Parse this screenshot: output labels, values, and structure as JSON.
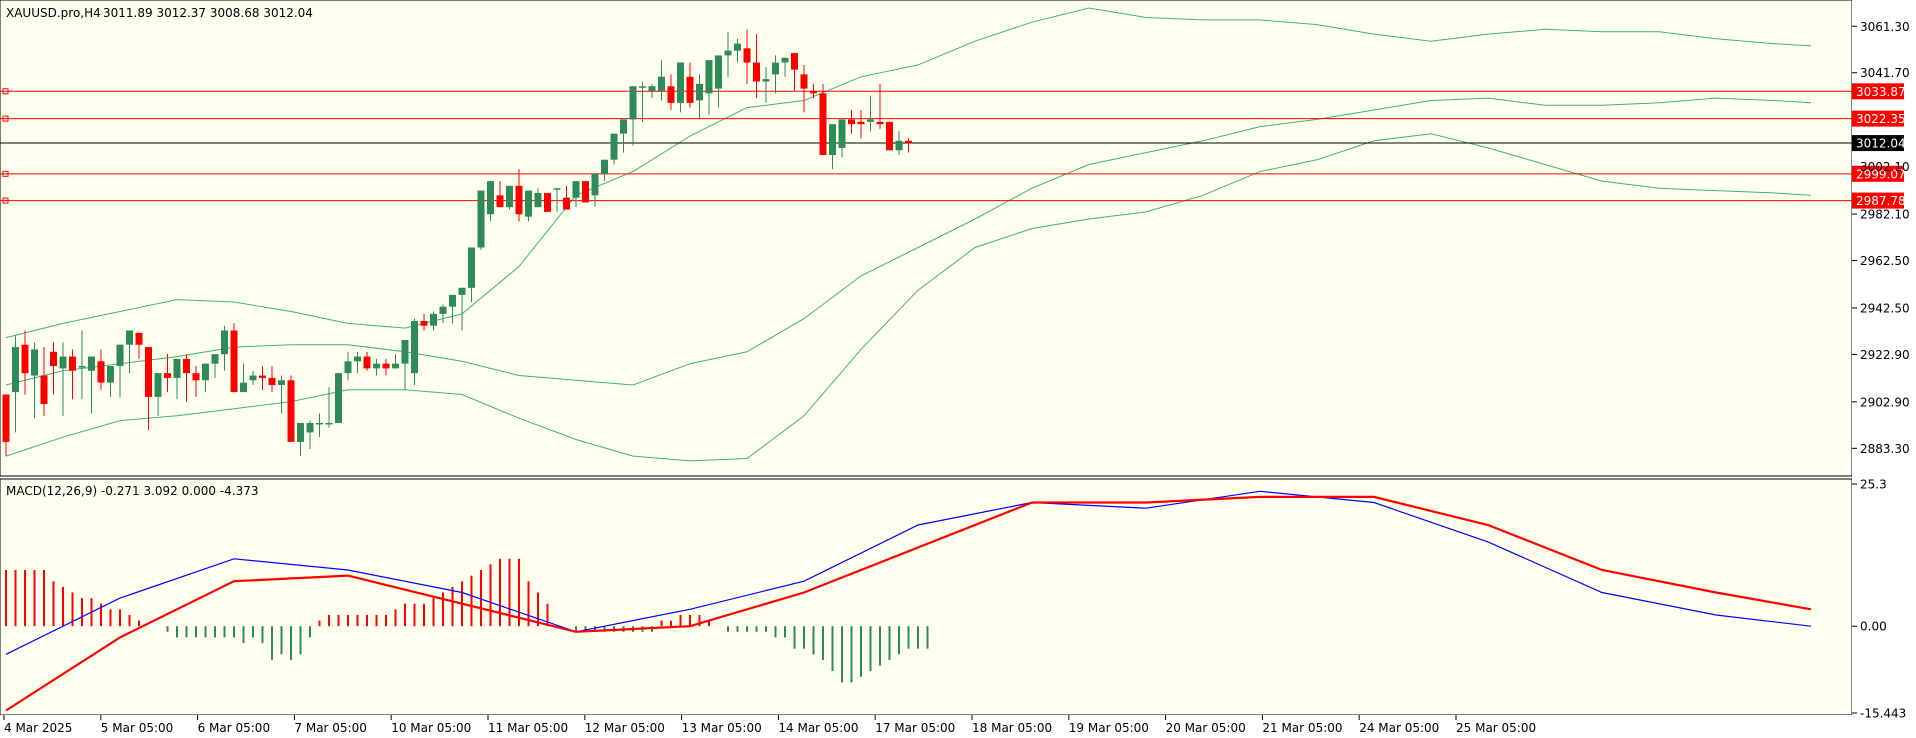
{
  "header": {
    "symbol": "XAUUSD.pro,H4",
    "ohlc": "3011.89 3012.37 3008.68 3012.04"
  },
  "macd_header": "MACD(12,26,9) -0.271 3.092 0.000 -4.373",
  "colors": {
    "background": "#fffff0",
    "bull": "#2e8b57",
    "bear": "#ff0000",
    "bands": "#3cb371",
    "macd_line": "#0000ff",
    "signal_line": "#ff0000",
    "level_line": "#ff0000",
    "price_line": "#000000"
  },
  "price_axis": [
    "3061.30",
    "3041.70",
    "2982.10",
    "2962.50",
    "2942.50",
    "2922.90",
    "2902.90",
    "2883.30"
  ],
  "macd_axis": [
    "25.3",
    "0.00",
    "-15.443"
  ],
  "time_labels": [
    "4 Mar 2025",
    "5 Mar 05:00",
    "6 Mar 05:00",
    "7 Mar 05:00",
    "10 Mar 05:00",
    "11 Mar 05:00",
    "12 Mar 05:00",
    "13 Mar 05:00",
    "14 Mar 05:00",
    "17 Mar 05:00",
    "18 Mar 05:00",
    "19 Mar 05:00",
    "20 Mar 05:00",
    "21 Mar 05:00",
    "24 Mar 05:00",
    "25 Mar 05:00"
  ],
  "levels": [
    {
      "value": 3033.87,
      "label": "3033.87"
    },
    {
      "value": 3022.35,
      "label": "3022.35"
    },
    {
      "value": 2999.07,
      "label": "2999.07"
    },
    {
      "value": 2987.78,
      "label": "2987.78"
    }
  ],
  "current_price": {
    "value": 3012.04,
    "label": "3012.04"
  },
  "partial_axis_label": "3002.10",
  "chart_data": {
    "type": "candlestick",
    "price_range": [
      2875,
      3069
    ],
    "macd_range": [
      -15.443,
      25.3
    ],
    "candles": [
      [
        2906,
        2906,
        2880,
        2886
      ],
      [
        2907,
        2931,
        2890,
        2926
      ],
      [
        2927,
        2933,
        2906,
        2915
      ],
      [
        2914,
        2928,
        2896,
        2925
      ],
      [
        2914,
        2926,
        2897,
        2902
      ],
      [
        2924,
        2928,
        2906,
        2918
      ],
      [
        2917,
        2928,
        2897,
        2922
      ],
      [
        2922,
        2925,
        2904,
        2916
      ],
      [
        2918,
        2933,
        2904,
        2918
      ],
      [
        2916,
        2920,
        2898,
        2922
      ],
      [
        2920,
        2925,
        2908,
        2911
      ],
      [
        2911,
        2915,
        2905,
        2918
      ],
      [
        2918,
        2919,
        2905,
        2927
      ],
      [
        2927,
        2929,
        2915,
        2933
      ],
      [
        2932,
        2930,
        2921,
        2927
      ],
      [
        2926,
        2926,
        2891,
        2905
      ],
      [
        2905,
        2914,
        2897,
        2915
      ],
      [
        2915,
        2923,
        2907,
        2913
      ],
      [
        2913,
        2918,
        2904,
        2921
      ],
      [
        2921,
        2923,
        2903,
        2915
      ],
      [
        2915,
        2918,
        2905,
        2912
      ],
      [
        2912,
        2916,
        2907,
        2919
      ],
      [
        2919,
        2919,
        2913,
        2923
      ],
      [
        2923,
        2935,
        2916,
        2933
      ],
      [
        2933,
        2936,
        2914,
        2907
      ],
      [
        2907,
        2919,
        2913,
        2911
      ],
      [
        2912,
        2916,
        2910,
        2914
      ],
      [
        2914,
        2918,
        2908,
        2913
      ],
      [
        2913,
        2918,
        2907,
        2910
      ],
      [
        2910,
        2914,
        2898,
        2912
      ],
      [
        2912,
        2914,
        2890,
        2886
      ],
      [
        2886,
        2886,
        2880,
        2894
      ],
      [
        2890,
        2895,
        2883,
        2894
      ],
      [
        2894,
        2898,
        2888,
        2894
      ],
      [
        2894,
        2909,
        2892,
        2894
      ],
      [
        2894,
        2912,
        2895,
        2915
      ],
      [
        2915,
        2924,
        2912,
        2920
      ],
      [
        2920,
        2924,
        2915,
        2922
      ],
      [
        2922,
        2924,
        2916,
        2917
      ],
      [
        2917,
        2921,
        2914,
        2919
      ],
      [
        2919,
        2921,
        2914,
        2917
      ],
      [
        2917,
        2923,
        2917,
        2919
      ],
      [
        2919,
        2919,
        2908,
        2929
      ],
      [
        2915,
        2938,
        2910,
        2937
      ],
      [
        2937,
        2940,
        2933,
        2935
      ],
      [
        2935,
        2941,
        2933,
        2940
      ],
      [
        2940,
        2944,
        2936,
        2943
      ],
      [
        2943,
        2945,
        2936,
        2948
      ],
      [
        2948,
        2949,
        2933,
        2951
      ],
      [
        2951,
        2953,
        2945,
        2968
      ],
      [
        2968,
        2982,
        2967,
        2992
      ],
      [
        2982,
        2992,
        2979,
        2996
      ],
      [
        2990,
        2996,
        2985,
        2985
      ],
      [
        2985,
        2993,
        2984,
        2994
      ],
      [
        2994,
        3001,
        2979,
        2982
      ],
      [
        2981,
        2989,
        2979,
        2992
      ],
      [
        2985,
        2993,
        2985,
        2991
      ],
      [
        2991,
        2991,
        2989,
        2983
      ],
      [
        2993,
        2993,
        2983,
        2993
      ],
      [
        2989,
        2994,
        2985,
        2984
      ],
      [
        2989,
        2996,
        2985,
        2996
      ],
      [
        2996,
        2994,
        2990,
        2987
      ],
      [
        2990,
        2996,
        2985,
        2999
      ],
      [
        2999,
        3003,
        2996,
        3005
      ],
      [
        3005,
        3009,
        3003,
        3016
      ],
      [
        3016,
        3020,
        3008,
        3022
      ],
      [
        3022,
        3022,
        3011,
        3036
      ],
      [
        3036,
        3038,
        3021,
        3036
      ],
      [
        3034,
        3037,
        3031,
        3036
      ],
      [
        3034,
        3047,
        3030,
        3040
      ],
      [
        3036,
        3041,
        3026,
        3029
      ],
      [
        3029,
        3043,
        3025,
        3046
      ],
      [
        3040,
        3046,
        3027,
        3029
      ],
      [
        3030,
        3041,
        3022,
        3037
      ],
      [
        3033,
        3039,
        3024,
        3047
      ],
      [
        3035,
        3047,
        3027,
        3049
      ],
      [
        3049,
        3059,
        3040,
        3051
      ],
      [
        3051,
        3056,
        3046,
        3054
      ],
      [
        3052,
        3060,
        3037,
        3046
      ],
      [
        3046,
        3058,
        3031,
        3038
      ],
      [
        3038,
        3044,
        3029,
        3039
      ],
      [
        3041,
        3049,
        3033,
        3046
      ],
      [
        3046,
        3045,
        3040,
        3048
      ],
      [
        3050,
        3048,
        3034,
        3043
      ],
      [
        3041,
        3045,
        3025,
        3035
      ],
      [
        3034,
        3037,
        3031,
        3033
      ],
      [
        3033,
        3037,
        3026,
        3007
      ],
      [
        3007,
        3016,
        3001,
        3020
      ],
      [
        3010,
        3022,
        3006,
        3022
      ],
      [
        3022,
        3026,
        3016,
        3020
      ],
      [
        3021,
        3026,
        3014,
        3020
      ],
      [
        3021,
        3032,
        3017,
        3022
      ],
      [
        3021,
        3037,
        3018,
        3020
      ],
      [
        3021,
        3014,
        3012,
        3009
      ],
      [
        3009,
        3017,
        3007,
        3013
      ],
      [
        3013,
        3014,
        3008,
        3012
      ]
    ],
    "bands": {
      "upper": [
        [
          0,
          2930
        ],
        [
          6,
          2936
        ],
        [
          12,
          2941
        ],
        [
          18,
          2946
        ],
        [
          24,
          2945
        ],
        [
          30,
          2941
        ],
        [
          36,
          2936
        ],
        [
          42,
          2934
        ],
        [
          48,
          2940
        ],
        [
          54,
          2960
        ],
        [
          60,
          2990
        ],
        [
          66,
          3000
        ],
        [
          72,
          3015
        ],
        [
          78,
          3027
        ],
        [
          84,
          3030
        ],
        [
          90,
          3040
        ],
        [
          96,
          3045
        ],
        [
          102,
          3055
        ],
        [
          108,
          3063
        ],
        [
          114,
          3069
        ],
        [
          120,
          3065
        ],
        [
          126,
          3064
        ],
        [
          132,
          3064
        ],
        [
          138,
          3062
        ],
        [
          144,
          3058
        ],
        [
          150,
          3055
        ],
        [
          156,
          3058
        ],
        [
          162,
          3060
        ],
        [
          168,
          3059
        ],
        [
          174,
          3059
        ],
        [
          180,
          3056
        ],
        [
          186,
          3054
        ],
        [
          190,
          3053
        ]
      ],
      "middle": [
        [
          0,
          2910
        ],
        [
          6,
          2916
        ],
        [
          12,
          2919
        ],
        [
          18,
          2922
        ],
        [
          24,
          2926
        ],
        [
          30,
          2927
        ],
        [
          36,
          2927
        ],
        [
          42,
          2924
        ],
        [
          48,
          2920
        ],
        [
          54,
          2914
        ],
        [
          60,
          2912
        ],
        [
          66,
          2910
        ],
        [
          72,
          2919
        ],
        [
          78,
          2924
        ],
        [
          84,
          2938
        ],
        [
          90,
          2956
        ],
        [
          96,
          2968
        ],
        [
          102,
          2980
        ],
        [
          108,
          2993
        ],
        [
          114,
          3003
        ],
        [
          120,
          3008
        ],
        [
          126,
          3013
        ],
        [
          132,
          3019
        ],
        [
          138,
          3022
        ],
        [
          144,
          3026
        ],
        [
          150,
          3030
        ],
        [
          156,
          3031
        ],
        [
          162,
          3028
        ],
        [
          168,
          3028
        ],
        [
          174,
          3029
        ],
        [
          180,
          3031
        ],
        [
          186,
          3030
        ],
        [
          190,
          3029
        ]
      ],
      "lower": [
        [
          0,
          2880
        ],
        [
          6,
          2888
        ],
        [
          12,
          2895
        ],
        [
          18,
          2897
        ],
        [
          24,
          2900
        ],
        [
          30,
          2903
        ],
        [
          36,
          2908
        ],
        [
          42,
          2908
        ],
        [
          48,
          2906
        ],
        [
          54,
          2896
        ],
        [
          60,
          2887
        ],
        [
          66,
          2880
        ],
        [
          72,
          2878
        ],
        [
          78,
          2879
        ],
        [
          84,
          2897
        ],
        [
          90,
          2925
        ],
        [
          96,
          2950
        ],
        [
          102,
          2968
        ],
        [
          108,
          2976
        ],
        [
          114,
          2980
        ],
        [
          120,
          2983
        ],
        [
          126,
          2990
        ],
        [
          132,
          3000
        ],
        [
          138,
          3005
        ],
        [
          144,
          3013
        ],
        [
          150,
          3016
        ],
        [
          156,
          3010
        ],
        [
          162,
          3003
        ],
        [
          168,
          2996
        ],
        [
          174,
          2993
        ],
        [
          180,
          2992
        ],
        [
          186,
          2991
        ],
        [
          190,
          2990
        ]
      ]
    },
    "macd_line": [
      [
        0,
        -5
      ],
      [
        12,
        5
      ],
      [
        24,
        12
      ],
      [
        36,
        10
      ],
      [
        48,
        6
      ],
      [
        60,
        -1
      ],
      [
        72,
        3
      ],
      [
        84,
        8
      ],
      [
        96,
        18
      ],
      [
        108,
        22
      ],
      [
        120,
        21
      ],
      [
        132,
        24
      ],
      [
        144,
        22
      ],
      [
        156,
        15
      ],
      [
        168,
        6
      ],
      [
        180,
        2
      ],
      [
        190,
        0
      ]
    ],
    "signal_line": [
      [
        0,
        -15
      ],
      [
        12,
        -2
      ],
      [
        24,
        8
      ],
      [
        36,
        9
      ],
      [
        48,
        4
      ],
      [
        60,
        -1
      ],
      [
        72,
        0
      ],
      [
        84,
        6
      ],
      [
        96,
        14
      ],
      [
        108,
        22
      ],
      [
        120,
        22
      ],
      [
        132,
        23
      ],
      [
        144,
        23
      ],
      [
        156,
        18
      ],
      [
        168,
        10
      ],
      [
        180,
        6
      ],
      [
        190,
        3
      ]
    ],
    "histogram": [
      10,
      10,
      10,
      10,
      10,
      8,
      7,
      6,
      5,
      5,
      4,
      3,
      3,
      2,
      1,
      0,
      0,
      -1,
      -2,
      -2,
      -2,
      -2,
      -2,
      -2,
      -2,
      -3,
      -2,
      -3,
      -6,
      -5,
      -6,
      -5,
      -2,
      1,
      2,
      2,
      2,
      2,
      2,
      2,
      2,
      3,
      4,
      4,
      4,
      5,
      6,
      7,
      8,
      9,
      10,
      11,
      12,
      12,
      12,
      8,
      6,
      4,
      0,
      0,
      -1,
      -1,
      -1,
      -1,
      -1,
      -1,
      -1,
      -1,
      -1,
      1,
      1,
      2,
      2,
      2,
      1,
      0,
      -1,
      -1,
      -1,
      -1,
      -1,
      -2,
      -2,
      -4,
      -4,
      -5,
      -6,
      -8,
      -10,
      -10,
      -9,
      -8,
      -7,
      -6,
      -5,
      -4,
      -4,
      -4
    ]
  }
}
